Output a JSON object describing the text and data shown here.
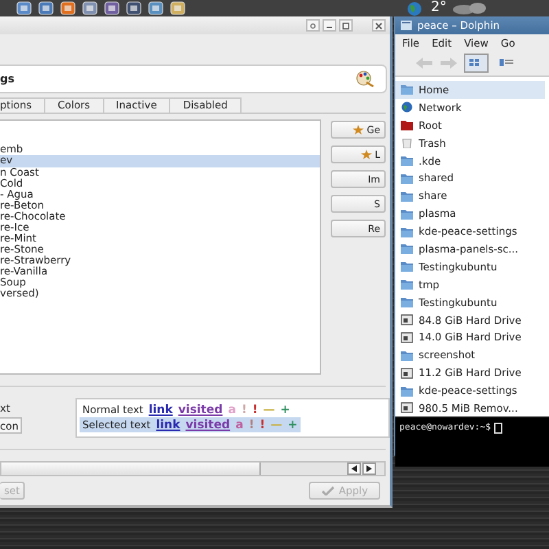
{
  "top_panel": {
    "temperature": "2°"
  },
  "settings_window": {
    "header_title": "gs",
    "tabs": [
      {
        "label": "ptions"
      },
      {
        "label": "Colors"
      },
      {
        "label": "Inactive"
      },
      {
        "label": "Disabled"
      }
    ],
    "schemes": [
      {
        "label": "emb",
        "selected": false
      },
      {
        "label": "ev",
        "selected": true
      },
      {
        "label": "n Coast",
        "selected": false
      },
      {
        "label": "Cold",
        "selected": false
      },
      {
        "label": "- Agua",
        "selected": false
      },
      {
        "label": "re-Beton",
        "selected": false
      },
      {
        "label": "re-Chocolate",
        "selected": false
      },
      {
        "label": "re-Ice",
        "selected": false
      },
      {
        "label": "re-Mint",
        "selected": false
      },
      {
        "label": "re-Stone",
        "selected": false
      },
      {
        "label": "re-Strawberry",
        "selected": false
      },
      {
        "label": "re-Vanilla",
        "selected": false
      },
      {
        "label": "Soup",
        "selected": false
      },
      {
        "label": "versed)",
        "selected": false
      }
    ],
    "side_buttons": [
      {
        "label": "Ge",
        "kind": "star"
      },
      {
        "label": "L",
        "kind": "star"
      },
      {
        "label": "Im",
        "kind": "plain"
      },
      {
        "label": "S",
        "kind": "plain"
      },
      {
        "label": "Re",
        "kind": "plain"
      }
    ],
    "option_label": "xt",
    "option_button": "con",
    "preview": [
      {
        "label": "Normal text",
        "selected": false,
        "tokens": [
          {
            "text": "link",
            "kind": "link",
            "color": "#2a2ab0"
          },
          {
            "text": "visited",
            "kind": "link",
            "color": "#7a3aa8"
          },
          {
            "text": "a",
            "kind": "plain",
            "color": "#e0a0c8"
          },
          {
            "text": "!",
            "kind": "plain",
            "color": "#d0a8a8"
          },
          {
            "text": "!",
            "kind": "plain",
            "color": "#c83030"
          },
          {
            "text": "—",
            "kind": "plain",
            "color": "#c8b040"
          },
          {
            "text": "+",
            "kind": "plain",
            "color": "#309060"
          }
        ]
      },
      {
        "label": "Selected text",
        "selected": true,
        "tokens": [
          {
            "text": "link",
            "kind": "link",
            "color": "#2a2ab0"
          },
          {
            "text": "visited",
            "kind": "link",
            "color": "#7a3aa8"
          },
          {
            "text": "a",
            "kind": "plain",
            "color": "#c060a0"
          },
          {
            "text": "!",
            "kind": "plain",
            "color": "#b08080"
          },
          {
            "text": "!",
            "kind": "plain",
            "color": "#c83030"
          },
          {
            "text": "—",
            "kind": "plain",
            "color": "#c8b040"
          },
          {
            "text": "+",
            "kind": "plain",
            "color": "#309060"
          }
        ]
      }
    ],
    "reset_button": "set",
    "apply_button": "Apply"
  },
  "dolphin_window": {
    "title": "peace – Dolphin",
    "menu": [
      "File",
      "Edit",
      "View",
      "Go"
    ],
    "places": [
      {
        "label": "Home",
        "kind": "home",
        "selected": true
      },
      {
        "label": "Network",
        "kind": "network",
        "selected": false
      },
      {
        "label": "Root",
        "kind": "root",
        "selected": false
      },
      {
        "label": "Trash",
        "kind": "trash",
        "selected": false
      },
      {
        "label": ".kde",
        "kind": "folder",
        "selected": false
      },
      {
        "label": "shared",
        "kind": "folder",
        "selected": false
      },
      {
        "label": "share",
        "kind": "folder",
        "selected": false
      },
      {
        "label": "plasma",
        "kind": "folder",
        "selected": false
      },
      {
        "label": "kde-peace-settings",
        "kind": "folder",
        "selected": false
      },
      {
        "label": "plasma-panels-sc...",
        "kind": "folder",
        "selected": false
      },
      {
        "label": "Testingkubuntu",
        "kind": "folder",
        "selected": false
      },
      {
        "label": "tmp",
        "kind": "folder",
        "selected": false
      },
      {
        "label": "Testingkubuntu",
        "kind": "folder",
        "selected": false
      },
      {
        "label": "84.8 GiB Hard Drive",
        "kind": "drive",
        "selected": false
      },
      {
        "label": "14.0 GiB Hard Drive",
        "kind": "drive",
        "selected": false
      },
      {
        "label": "screenshot",
        "kind": "folder",
        "selected": false
      },
      {
        "label": "11.2 GiB Hard Drive",
        "kind": "drive",
        "selected": false
      },
      {
        "label": "kde-peace-settings",
        "kind": "folder",
        "selected": false
      },
      {
        "label": "980.5 MiB Remov...",
        "kind": "drive",
        "selected": false
      }
    ],
    "terminal_prompt": "peace@nowardev:~$"
  }
}
